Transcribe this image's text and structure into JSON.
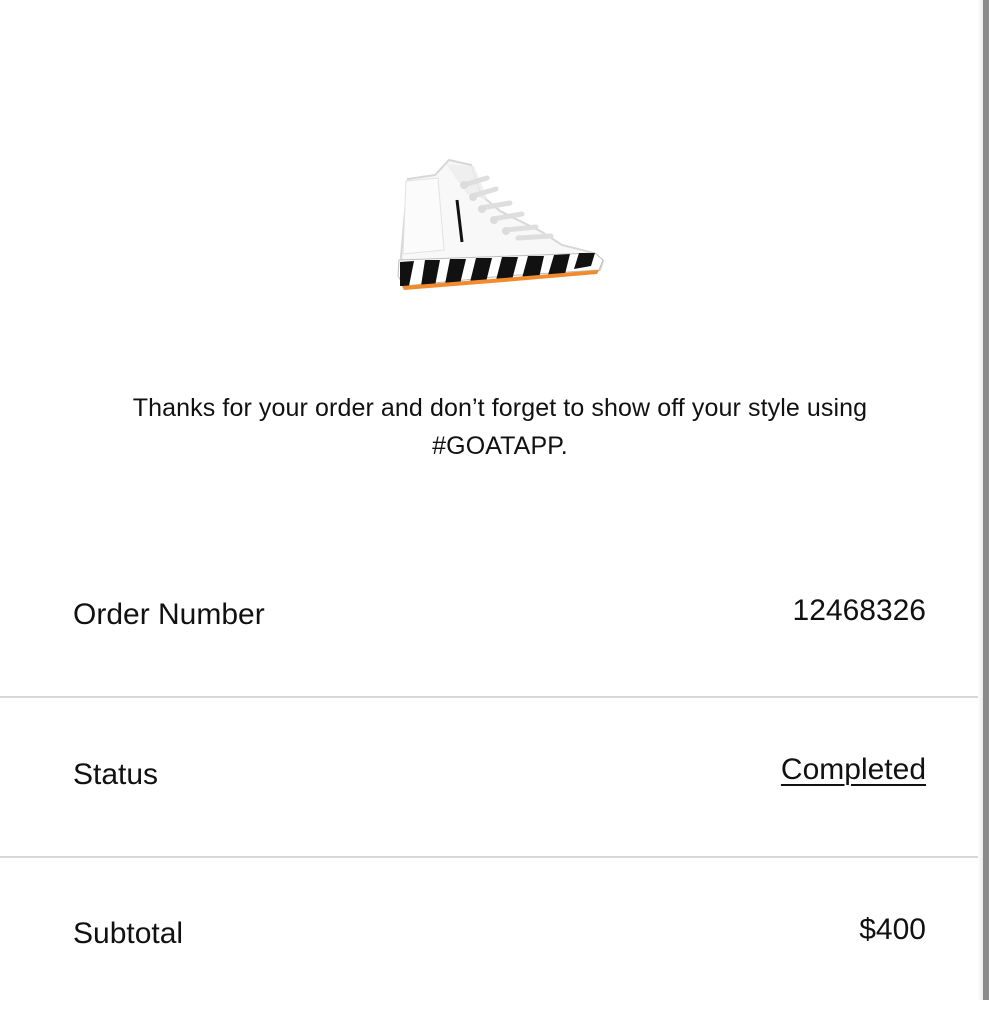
{
  "product": {
    "image_alt": "Converse Chuck 70 Hi x Off-White sneaker"
  },
  "message": {
    "text": "Thanks for your order and don’t forget to show off your style using #GOATAPP."
  },
  "order_details": {
    "order_number": {
      "label": "Order Number",
      "value": "12468326"
    },
    "status": {
      "label": "Status",
      "value": "Completed"
    },
    "subtotal": {
      "label": "Subtotal",
      "value": "$400"
    }
  },
  "colors": {
    "text": "#111111",
    "divider": "#d8d8d8",
    "background": "#ffffff",
    "sole_accent": "#f28b2e"
  },
  "icons": [
    "sneaker-product-image"
  ]
}
